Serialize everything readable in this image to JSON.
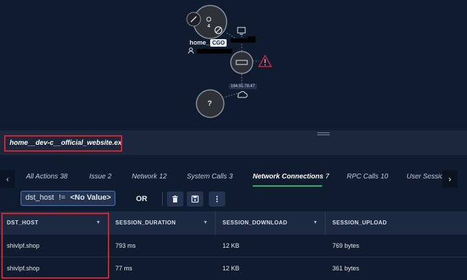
{
  "graph": {
    "process_node": {
      "label": "home_",
      "badge": "CGO",
      "count": "4"
    },
    "ip_address": "164.91.78.47",
    "unknown_node_label": "?"
  },
  "process_path": "home__dev-c__official_website.exe",
  "tabs": [
    {
      "label": "All Actions",
      "count": "38"
    },
    {
      "label": "Issue",
      "count": "2"
    },
    {
      "label": "Network",
      "count": "12"
    },
    {
      "label": "System Calls",
      "count": "3"
    },
    {
      "label": "Network Connections",
      "count": "7",
      "active": true
    },
    {
      "label": "RPC Calls",
      "count": "10"
    },
    {
      "label": "User Sessio",
      "count": ""
    }
  ],
  "filter": {
    "field": "dst_host",
    "operator": "!=",
    "value": "<No Value>",
    "or_label": "OR"
  },
  "table": {
    "columns": [
      "DST_HOST",
      "SESSION_DURATION",
      "SESSION_DOWNLOAD",
      "SESSION_UPLOAD"
    ],
    "rows": [
      [
        "shivlpf.shop",
        "793 ms",
        "12 KB",
        "769 bytes"
      ],
      [
        "shivlpf.shop",
        "77 ms",
        "12 KB",
        "361 bytes"
      ]
    ]
  },
  "colors": {
    "background": "#0f1b2e",
    "highlight": "#d8232a",
    "active_tab_underline": "#2fb56b",
    "alert": "#c8283a"
  }
}
